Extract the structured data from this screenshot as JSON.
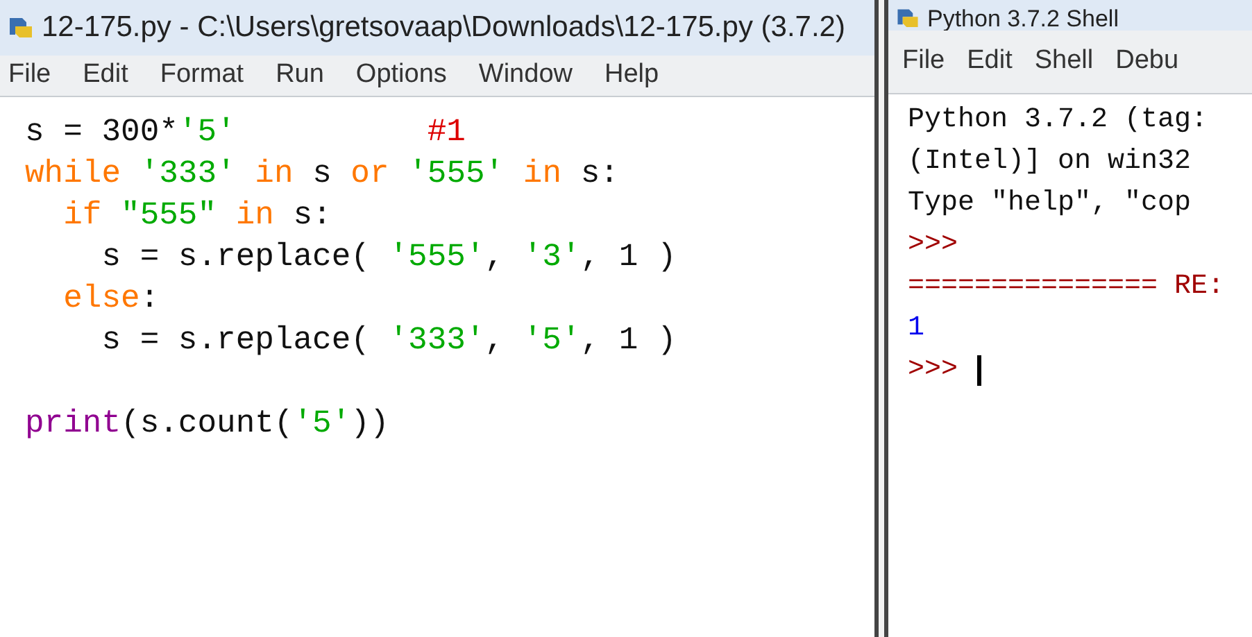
{
  "editor": {
    "title": "12-175.py - C:\\Users\\gretsovaap\\Downloads\\12-175.py (3.7.2)",
    "menu": [
      "File",
      "Edit",
      "Format",
      "Run",
      "Options",
      "Window",
      "Help"
    ],
    "lines": [
      {
        "tokens": [
          {
            "kind": "plain",
            "text": "s = 300*"
          },
          {
            "kind": "string",
            "text": "'5'"
          },
          {
            "kind": "comment",
            "text": "          #1"
          }
        ]
      },
      {
        "tokens": [
          {
            "kind": "keyword",
            "text": "while"
          },
          {
            "kind": "string",
            "text": " '333'"
          },
          {
            "kind": "keyword",
            "text": " in"
          },
          {
            "kind": "plain",
            "text": " s"
          },
          {
            "kind": "keyword",
            "text": " or"
          },
          {
            "kind": "string",
            "text": " '555'"
          },
          {
            "kind": "keyword",
            "text": " in"
          },
          {
            "kind": "plain",
            "text": " s:"
          }
        ]
      },
      {
        "tokens": [
          {
            "kind": "keyword",
            "text": "  if"
          },
          {
            "kind": "string",
            "text": " \"555\""
          },
          {
            "kind": "keyword",
            "text": " in"
          },
          {
            "kind": "plain",
            "text": " s:"
          }
        ]
      },
      {
        "tokens": [
          {
            "kind": "plain",
            "text": "    s = s.replace( "
          },
          {
            "kind": "string",
            "text": "'555'"
          },
          {
            "kind": "plain",
            "text": ", "
          },
          {
            "kind": "string",
            "text": "'3'"
          },
          {
            "kind": "plain",
            "text": ", 1 )"
          }
        ]
      },
      {
        "tokens": [
          {
            "kind": "keyword",
            "text": "  else"
          },
          {
            "kind": "plain",
            "text": ":"
          }
        ]
      },
      {
        "tokens": [
          {
            "kind": "plain",
            "text": "    s = s.replace( "
          },
          {
            "kind": "string",
            "text": "'333'"
          },
          {
            "kind": "plain",
            "text": ", "
          },
          {
            "kind": "string",
            "text": "'5'"
          },
          {
            "kind": "plain",
            "text": ", 1 )"
          }
        ]
      },
      {
        "blank_before": true,
        "tokens": [
          {
            "kind": "builtin",
            "text": "print"
          },
          {
            "kind": "plain",
            "text": "(s.count("
          },
          {
            "kind": "string",
            "text": "'5'"
          },
          {
            "kind": "plain",
            "text": "))"
          }
        ]
      }
    ]
  },
  "shell": {
    "title": "Python 3.7.2 Shell",
    "menu": [
      "File",
      "Edit",
      "Shell",
      "Debu"
    ],
    "lines": [
      {
        "kind": "output",
        "text": "Python 3.7.2 (tag:"
      },
      {
        "kind": "output",
        "text": "(Intel)] on win32"
      },
      {
        "kind": "output",
        "text": "Type \"help\", \"cop"
      },
      {
        "kind": "prompt",
        "text": ">>>"
      },
      {
        "kind": "restart",
        "text": "=============== RE:"
      },
      {
        "kind": "result",
        "text": "1"
      },
      {
        "kind": "prompt",
        "text": ">>>",
        "cursor": true
      }
    ]
  }
}
